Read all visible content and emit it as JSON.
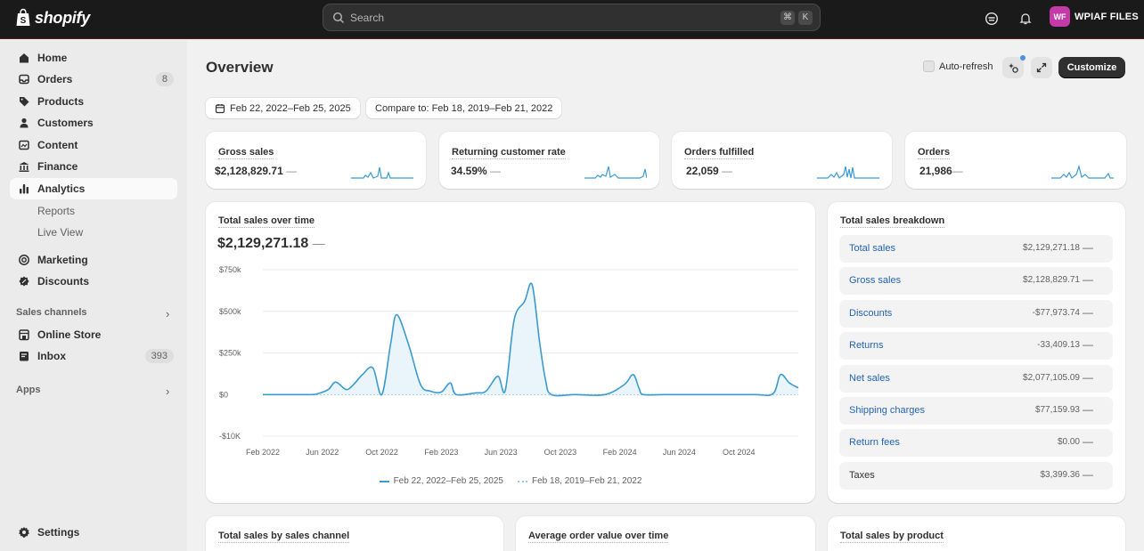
{
  "topbar": {
    "brand": "shopify",
    "search_placeholder": "Search",
    "shortcut_keys": [
      "⌘",
      "K"
    ],
    "store_initials": "WF",
    "store_name": "WPIAF FILES"
  },
  "sidebar": {
    "items": [
      {
        "label": "Home",
        "icon": "home-icon"
      },
      {
        "label": "Orders",
        "icon": "orders-icon",
        "count": "8"
      },
      {
        "label": "Products",
        "icon": "tag-icon"
      },
      {
        "label": "Customers",
        "icon": "person-icon"
      },
      {
        "label": "Content",
        "icon": "content-icon"
      },
      {
        "label": "Finance",
        "icon": "bank-icon"
      },
      {
        "label": "Analytics",
        "icon": "bar-chart-icon",
        "active": true
      }
    ],
    "analytics_sub": [
      "Reports",
      "Live View"
    ],
    "items2": [
      {
        "label": "Marketing",
        "icon": "target-icon"
      },
      {
        "label": "Discounts",
        "icon": "discount-icon"
      }
    ],
    "sales_channels_label": "Sales channels",
    "channels": [
      {
        "label": "Online Store",
        "icon": "store-icon"
      },
      {
        "label": "Inbox",
        "icon": "inbox-icon",
        "count": "393"
      }
    ],
    "apps_label": "Apps",
    "settings_label": "Settings"
  },
  "header": {
    "title": "Overview",
    "auto_refresh": "Auto-refresh",
    "customize": "Customize",
    "date_range": "Feb 22, 2022–Feb 25, 2025",
    "compare": "Compare to: Feb 18, 2019–Feb 21, 2022"
  },
  "kpis": [
    {
      "title": "Gross sales",
      "value": "$2,128,829.71",
      "change": "—"
    },
    {
      "title": "Returning customer rate",
      "value": "34.59%",
      "change": "—"
    },
    {
      "title": "Orders fulfilled",
      "value": "22,059",
      "change": "—"
    },
    {
      "title": "Orders",
      "value": "21,986",
      "change": "—"
    }
  ],
  "sales_over_time": {
    "title": "Total sales over time",
    "value": "$2,129,271.18",
    "change": "—"
  },
  "chart_data": {
    "type": "line",
    "ytick_labels": [
      "$750k",
      "$500k",
      "$250k",
      "$0",
      "-$10K"
    ],
    "yticks": [
      750000,
      500000,
      250000,
      0,
      -250000
    ],
    "xtick_labels": [
      "Feb 2022",
      "Jun 2022",
      "Oct 2022",
      "Feb 2023",
      "Jun 2023",
      "Oct 2023",
      "Feb 2024",
      "Jun 2024",
      "Oct 2024"
    ],
    "xticks": [
      0,
      4,
      8,
      12,
      16,
      20,
      24,
      28,
      32
    ],
    "xlim": [
      0,
      36
    ],
    "ylim": [
      -250000,
      750000
    ],
    "series": [
      {
        "name": "Feb 22, 2022–Feb 25, 2025",
        "color": "#3b9bd1",
        "points": [
          [
            0,
            0
          ],
          [
            1,
            0
          ],
          [
            2,
            0
          ],
          [
            3,
            0
          ],
          [
            3.3,
            0
          ],
          [
            3.7,
            5000
          ],
          [
            4.4,
            30000
          ],
          [
            4.9,
            75000
          ],
          [
            5.6,
            30000
          ],
          [
            6.1,
            60000
          ],
          [
            6.7,
            120000
          ],
          [
            7.4,
            160000
          ],
          [
            8,
            0
          ],
          [
            8.6,
            310000
          ],
          [
            9,
            480000
          ],
          [
            9.8,
            300000
          ],
          [
            10.6,
            60000
          ],
          [
            11.3,
            20000
          ],
          [
            12,
            15000
          ],
          [
            12.6,
            70000
          ],
          [
            13,
            0
          ],
          [
            14.3,
            10000
          ],
          [
            15,
            20000
          ],
          [
            15.8,
            110000
          ],
          [
            16.3,
            25000
          ],
          [
            16.9,
            450000
          ],
          [
            17.6,
            560000
          ],
          [
            18.1,
            660000
          ],
          [
            18.6,
            320000
          ],
          [
            19,
            90000
          ],
          [
            19.4,
            0
          ],
          [
            21,
            0
          ],
          [
            23,
            0
          ],
          [
            24.3,
            60000
          ],
          [
            24.9,
            120000
          ],
          [
            25.3,
            35000
          ],
          [
            25.6,
            0
          ],
          [
            27,
            0
          ],
          [
            30,
            0
          ],
          [
            33,
            0
          ],
          [
            34.3,
            5000
          ],
          [
            34.8,
            120000
          ],
          [
            35.4,
            70000
          ],
          [
            36,
            40000
          ]
        ]
      },
      {
        "name": "Feb 18, 2019–Feb 21, 2022",
        "color": "#8fc9e8",
        "points": [
          [
            0,
            0
          ],
          [
            36,
            0
          ]
        ]
      }
    ]
  },
  "breakdown": {
    "title": "Total sales breakdown",
    "rows": [
      {
        "label": "Total sales",
        "value": "$2,129,271.18",
        "change": "—",
        "link": true
      },
      {
        "label": "Gross sales",
        "value": "$2,128,829.71",
        "change": "—",
        "link": true
      },
      {
        "label": "Discounts",
        "value": "-$77,973.74",
        "change": "—",
        "link": true
      },
      {
        "label": "Returns",
        "value": "-33,409.13",
        "change": "—",
        "link": true
      },
      {
        "label": "Net sales",
        "value": "$2,077,105.09",
        "change": "—",
        "link": true
      },
      {
        "label": "Shipping charges",
        "value": "$77,159.93",
        "change": "—",
        "link": true
      },
      {
        "label": "Return fees",
        "value": "$0.00",
        "change": "—",
        "link": true
      },
      {
        "label": "Taxes",
        "value": "$3,399.36",
        "change": "—",
        "link": false
      }
    ]
  },
  "bottom_cards": [
    "Total sales by sales channel",
    "Average order value over time",
    "Total sales by product"
  ]
}
